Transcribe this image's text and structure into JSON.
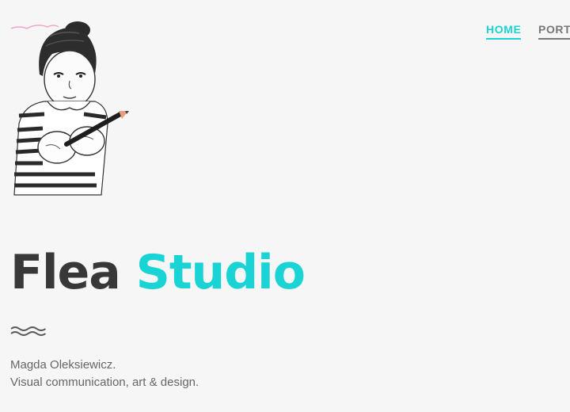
{
  "nav": {
    "items": [
      {
        "label": "HOME",
        "active": true
      },
      {
        "label": "PORTFOLIO",
        "active": false
      }
    ]
  },
  "hero": {
    "title_part1": "Flea",
    "title_part2": "Studio",
    "tagline_line1": "Magda Oleksiewicz.",
    "tagline_line2": "Visual communication, art & design."
  },
  "colors": {
    "accent": "#1ad3d5",
    "title_dark": "#383838",
    "text_gray": "#666666",
    "background": "#f6f6f6"
  },
  "icons": {
    "logo": "girl-with-pencil-illustration",
    "divider": "wave-divider-icon"
  }
}
